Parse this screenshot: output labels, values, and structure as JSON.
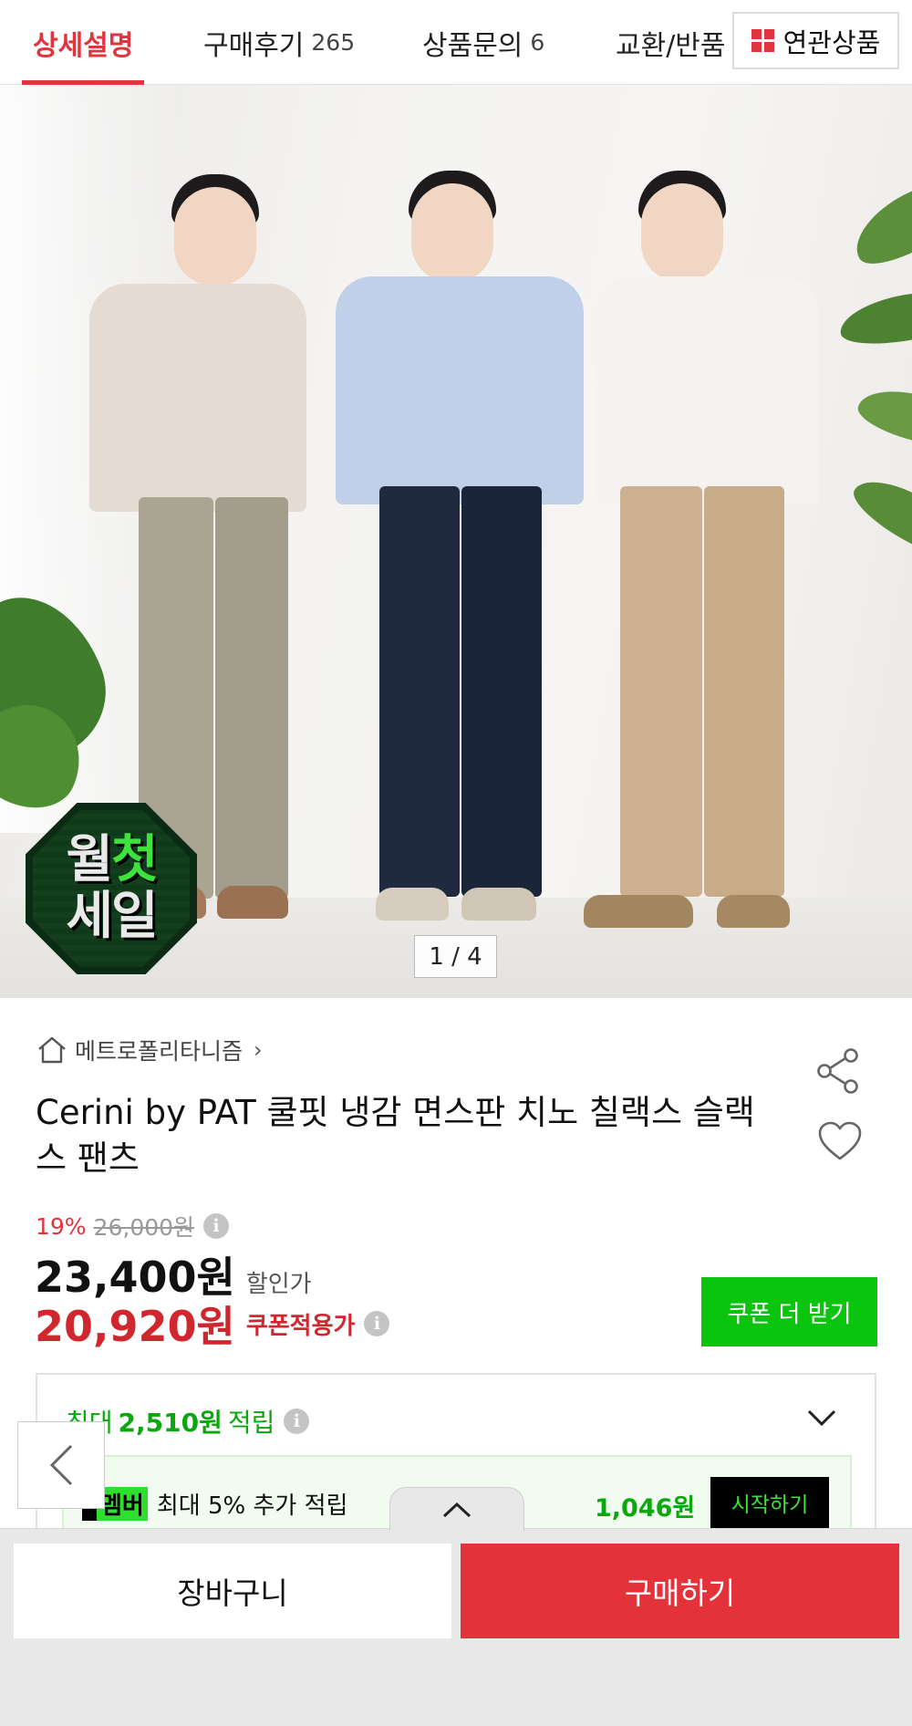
{
  "tabs": [
    {
      "label": "상세설명",
      "count": ""
    },
    {
      "label": "구매후기",
      "count": "265"
    },
    {
      "label": "상품문의",
      "count": "6"
    },
    {
      "label": "교환/반품",
      "count": ""
    }
  ],
  "related_button": {
    "label": "연관상품",
    "icon": "grid-icon",
    "icon_color": "#e0343e"
  },
  "hero": {
    "badge_line1_a": "월",
    "badge_line1_b": "첫",
    "badge_line2": "세일",
    "counter": "1 / 4"
  },
  "product": {
    "brand": "메트로폴리타니즘",
    "brand_chevron": "›",
    "title": "Cerini by PAT 쿨핏 냉감 면스판 치노 칠랙스 슬랙스 팬츠",
    "discount_pct": "19%",
    "original_price": "26,000원",
    "sale_price": "23,400원",
    "sale_label": "할인가",
    "coupon_price": "20,920원",
    "coupon_label": "쿠폰적용가",
    "coupon_button": "쿠폰 더 받기"
  },
  "points": {
    "prefix": "최대",
    "amount": "2,510원",
    "suffix": "적립",
    "member_tag": "멤버",
    "member_text": "최대 5% 추가 적립",
    "member_amount": "1,046원",
    "start_button": "시작하기"
  },
  "bottom_bar": {
    "cart": "장바구니",
    "buy": "구매하기"
  },
  "colors": {
    "accent_red": "#e0343e",
    "buy_red": "#e4323b",
    "coupon_green": "#0ac40e",
    "point_green": "#0aa70e"
  }
}
